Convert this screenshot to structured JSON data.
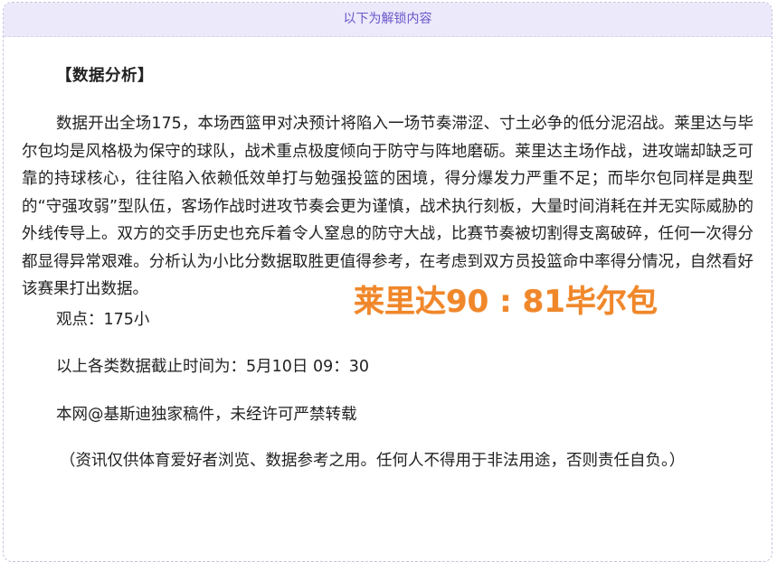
{
  "unlock_bar": {
    "label": "以下为解锁内容"
  },
  "article": {
    "section_title": "【数据分析】",
    "analysis": "数据开出全场175，本场西篮甲对决预计将陷入一场节奏滞涩、寸土必争的低分泥沼战。莱里达与毕尔包均是风格极为保守的球队，战术重点极度倾向于防守与阵地磨砺。莱里达主场作战，进攻端却缺乏可靠的持球核心，往往陷入依赖低效单打与勉强投篮的困境，得分爆发力严重不足；而毕尔包同样是典型的“守强攻弱”型队伍，客场作战时进攻节奏会更为谨慎，战术执行刻板，大量时间消耗在并无实际威胁的外线传导上。双方的交手历史也充斥着令人窒息的防守大战，比赛节奏被切割得支离破碎，任何一次得分都显得异常艰难。分析认为小比分数据取胜更值得参考，在考虑到双方员投篮命中率得分情况，自然看好该赛果打出数据。",
    "viewpoint": "观点：175小",
    "cutoff": "以上各类数据截止时间为：5月10日 09：30",
    "copyright": "本网@基斯迪独家稿件，未经许可严禁转载",
    "disclaimer": "（资讯仅供体育爱好者浏览、数据参考之用。任何人不得用于非法用途，否则责任自负。）"
  },
  "score_overlay": {
    "text": "莱里达90 : 81毕尔包",
    "color": "#f0872a"
  },
  "colors": {
    "unlock_bar_bg": "#ece9fb",
    "unlock_text": "#6a55c9",
    "body_text": "#222222",
    "border": "#c8c4dc"
  }
}
